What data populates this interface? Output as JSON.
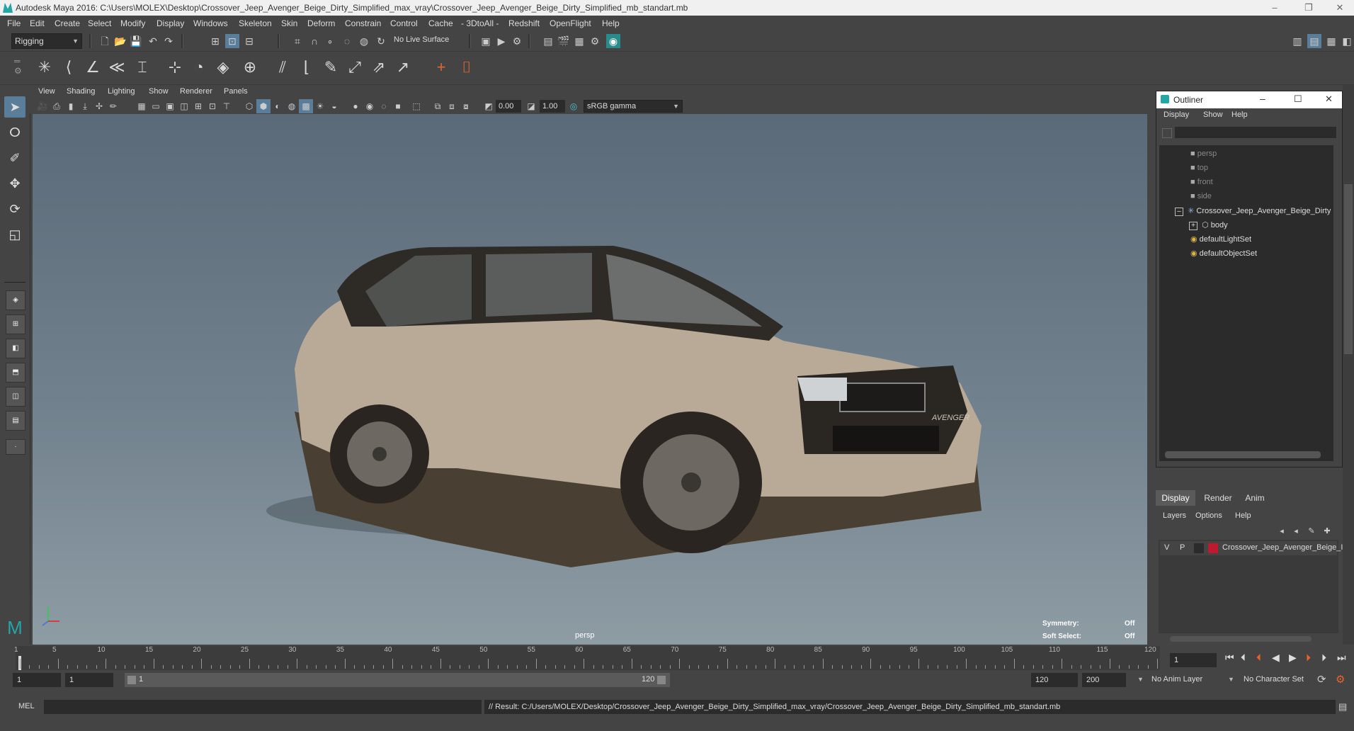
{
  "window": {
    "title": "Autodesk Maya 2016: C:\\Users\\MOLEX\\Desktop\\Crossover_Jeep_Avenger_Beige_Dirty_Simplified_max_vray\\Crossover_Jeep_Avenger_Beige_Dirty_Simplified_mb_standart.mb",
    "minimize": "–",
    "restore": "❐",
    "close": "✕"
  },
  "menubar": [
    "File",
    "Edit",
    "Create",
    "Select",
    "Modify",
    "Display",
    "Windows",
    "Skeleton",
    "Skin",
    "Deform",
    "Constrain",
    "Control",
    "Cache",
    "- 3DtoAll -",
    "Redshift",
    "OpenFlight",
    "Help"
  ],
  "statusline": {
    "menuset": "Rigging",
    "live_surface": "No Live Surface"
  },
  "viewport": {
    "menus": [
      "View",
      "Shading",
      "Lighting",
      "Show",
      "Renderer",
      "Panels"
    ],
    "exposure": "0.00",
    "gamma": "1.00",
    "color_space": "sRGB gamma",
    "camera_label": "persp",
    "hud": {
      "symmetry_label": "Symmetry:",
      "symmetry_value": "Off",
      "soft_select_label": "Soft Select:",
      "soft_select_value": "Off"
    },
    "car_badge": "AVENGER"
  },
  "outliner": {
    "title": "Outliner",
    "menus": [
      "Display",
      "Show",
      "Help"
    ],
    "items": [
      {
        "label": "persp",
        "icon": "camera-icon",
        "dim": true
      },
      {
        "label": "top",
        "icon": "camera-icon",
        "dim": true
      },
      {
        "label": "front",
        "icon": "camera-icon",
        "dim": true
      },
      {
        "label": "side",
        "icon": "camera-icon",
        "dim": true
      },
      {
        "label": "Crossover_Jeep_Avenger_Beige_Dirty",
        "icon": "joint-icon",
        "dim": false
      },
      {
        "label": "body",
        "icon": "mesh-icon",
        "dim": false
      },
      {
        "label": "defaultLightSet",
        "icon": "set-icon",
        "dim": false
      },
      {
        "label": "defaultObjectSet",
        "icon": "set-icon",
        "dim": false
      }
    ]
  },
  "layer_editor": {
    "tabs": [
      "Display",
      "Render",
      "Anim"
    ],
    "menus": [
      "Layers",
      "Options",
      "Help"
    ],
    "layer": {
      "v": "V",
      "p": "P",
      "name": "Crossover_Jeep_Avenger_Beige_I",
      "color": "#c0182e"
    }
  },
  "timeline": {
    "ticks": [
      1,
      5,
      10,
      15,
      20,
      25,
      30,
      35,
      40,
      45,
      50,
      55,
      60,
      65,
      70,
      75,
      80,
      85,
      90,
      95,
      100,
      105,
      110,
      115,
      120
    ],
    "current_frame": "1"
  },
  "range": {
    "start": "1",
    "playback_start": "1",
    "slider_start": "1",
    "slider_end": "120",
    "playback_end": "120",
    "end": "200",
    "anim_layer": "No Anim Layer",
    "char_set": "No Character Set"
  },
  "command": {
    "label": "MEL",
    "result": "// Result: C:/Users/MOLEX/Desktop/Crossover_Jeep_Avenger_Beige_Dirty_Simplified_max_vray/Crossover_Jeep_Avenger_Beige_Dirty_Simplified_mb_standart.mb"
  },
  "colors": {
    "accent": "#5a7d9a",
    "layer_color": "#c0182e",
    "maya_teal": "#23a6a6"
  }
}
